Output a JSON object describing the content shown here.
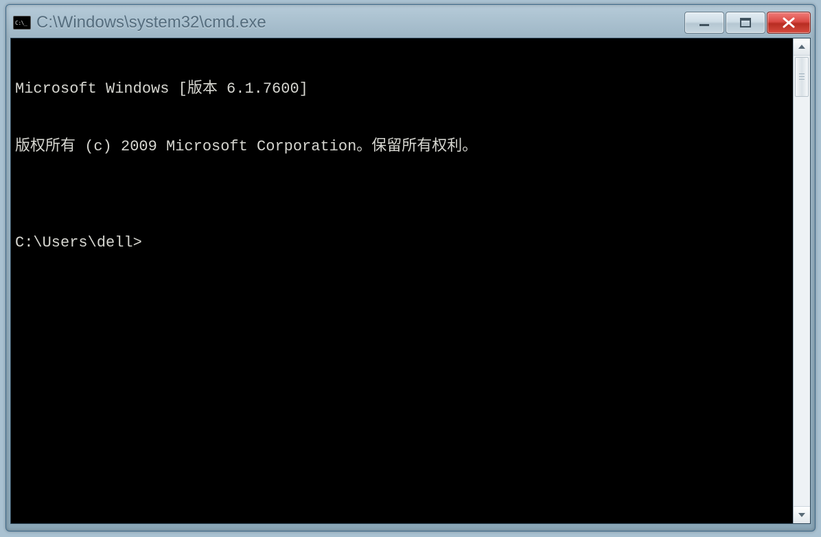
{
  "window": {
    "title": "C:\\Windows\\system32\\cmd.exe"
  },
  "terminal": {
    "lines": [
      "Microsoft Windows [版本 6.1.7600]",
      "版权所有 (c) 2009 Microsoft Corporation。保留所有权利。",
      "",
      "C:\\Users\\dell>"
    ]
  }
}
